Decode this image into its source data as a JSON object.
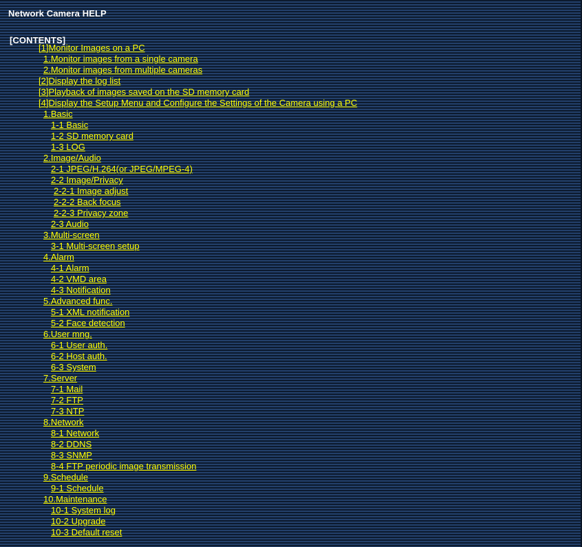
{
  "page": {
    "document_title": "Network Camera HELP",
    "heading": "Network Camera HELP",
    "contents_heading": "[CONTENTS]"
  },
  "colors": {
    "link": "#ffff00",
    "heading_text": "#ffffff",
    "background_dark_stripe": "#0c1a2e",
    "background_light_stripe": "#23406b"
  },
  "toc": {
    "items": [
      {
        "label": "[1]Monitor Images on a PC",
        "level": 0
      },
      {
        "label": "1.Monitor images from a single camera",
        "level": 1
      },
      {
        "label": "2.Monitor images from multiple cameras",
        "level": 1
      },
      {
        "label": "[2]Display the log list",
        "level": 0
      },
      {
        "label": "[3]Playback of images saved on the SD memory card",
        "level": 0
      },
      {
        "label": "[4]Display the Setup Menu and Configure the Settings of the Camera using a PC",
        "level": 0
      },
      {
        "label": "1.Basic",
        "level": 1
      },
      {
        "label": "1-1 Basic",
        "level": 2
      },
      {
        "label": "1-2 SD memory card",
        "level": 2
      },
      {
        "label": "1-3 LOG",
        "level": 2
      },
      {
        "label": "2.Image/Audio",
        "level": 1
      },
      {
        "label": "2-1 JPEG/H.264(or JPEG/MPEG-4)",
        "level": 2
      },
      {
        "label": "2-2 Image/Privacy",
        "level": 2
      },
      {
        "label": "2-2-1 Image adjust",
        "level": 3
      },
      {
        "label": "2-2-2 Back focus",
        "level": 3
      },
      {
        "label": "2-2-3 Privacy zone",
        "level": 3
      },
      {
        "label": "2-3 Audio",
        "level": 2
      },
      {
        "label": "3.Multi-screen",
        "level": 1
      },
      {
        "label": "3-1 Multi-screen setup",
        "level": 2
      },
      {
        "label": "4.Alarm",
        "level": 1
      },
      {
        "label": "4-1 Alarm",
        "level": 2
      },
      {
        "label": "4-2 VMD area",
        "level": 2
      },
      {
        "label": "4-3 Notification",
        "level": 2
      },
      {
        "label": "5.Advanced func.",
        "level": 1
      },
      {
        "label": "5-1 XML notification",
        "level": 2
      },
      {
        "label": "5-2 Face detection",
        "level": 2
      },
      {
        "label": "6.User mng.",
        "level": 1
      },
      {
        "label": "6-1 User auth.",
        "level": 2
      },
      {
        "label": "6-2 Host auth.",
        "level": 2
      },
      {
        "label": "6-3 System",
        "level": 2
      },
      {
        "label": "7.Server",
        "level": 1
      },
      {
        "label": "7-1 Mail",
        "level": 2
      },
      {
        "label": "7-2 FTP",
        "level": 2
      },
      {
        "label": "7-3 NTP",
        "level": 2
      },
      {
        "label": "8.Network",
        "level": 1
      },
      {
        "label": "8-1 Network",
        "level": 2
      },
      {
        "label": "8-2 DDNS",
        "level": 2
      },
      {
        "label": "8-3 SNMP",
        "level": 2
      },
      {
        "label": "8-4 FTP periodic image transmission",
        "level": 2
      },
      {
        "label": "9.Schedule",
        "level": 1
      },
      {
        "label": "9-1 Schedule",
        "level": 2
      },
      {
        "label": "10.Maintenance",
        "level": 1
      },
      {
        "label": "10-1 System log",
        "level": 2
      },
      {
        "label": "10-2 Upgrade",
        "level": 2
      },
      {
        "label": "10-3 Default reset",
        "level": 2
      }
    ]
  }
}
